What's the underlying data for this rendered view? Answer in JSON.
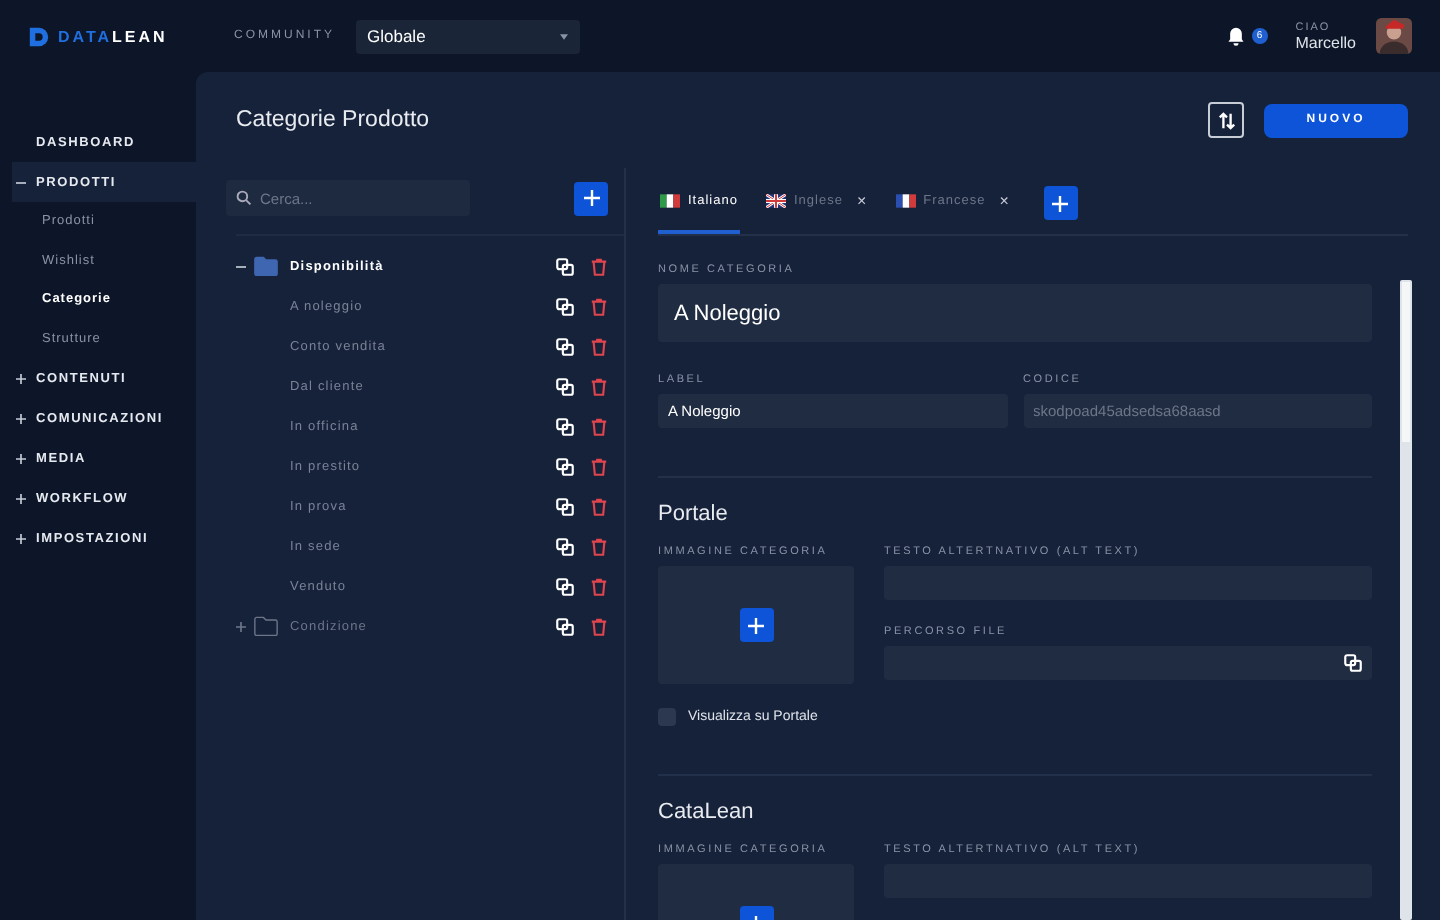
{
  "topbar": {
    "logo": [
      "DATA",
      "LEAN"
    ],
    "community_label": "COMMUNITY",
    "community_value": "Globale",
    "notifications": "6",
    "greeting": "CIAO",
    "user": "Marcello"
  },
  "sidebar": {
    "items": [
      {
        "label": "DASHBOARD",
        "kind": "link"
      },
      {
        "label": "PRODOTTI",
        "kind": "group",
        "expanded": true,
        "selected": true,
        "children": [
          {
            "label": "Prodotti",
            "selected": false
          },
          {
            "label": "Wishlist",
            "selected": false
          },
          {
            "label": "Categorie",
            "selected": true
          },
          {
            "label": "Strutture",
            "selected": false
          }
        ]
      },
      {
        "label": "CONTENUTI",
        "kind": "group",
        "expanded": false,
        "selected": false
      },
      {
        "label": "COMUNICAZIONI",
        "kind": "group",
        "expanded": false,
        "selected": false
      },
      {
        "label": "MEDIA",
        "kind": "group",
        "expanded": false,
        "selected": false
      },
      {
        "label": "WORKFLOW",
        "kind": "group",
        "expanded": false,
        "selected": false
      },
      {
        "label": "IMPOSTAZIONI",
        "kind": "group",
        "expanded": false,
        "selected": false
      }
    ]
  },
  "page": {
    "title": "Categorie Prodotto",
    "new_button": "NUOVO"
  },
  "search": {
    "placeholder": "Cerca..."
  },
  "tree": [
    {
      "label": "Disponibilità",
      "expanded": true,
      "children": [
        {
          "label": "A noleggio"
        },
        {
          "label": "Conto vendita"
        },
        {
          "label": "Dal cliente"
        },
        {
          "label": "In officina"
        },
        {
          "label": "In prestito"
        },
        {
          "label": "In prova"
        },
        {
          "label": "In sede"
        },
        {
          "label": "Venduto"
        }
      ]
    },
    {
      "label": "Condizione",
      "expanded": false
    }
  ],
  "tabs": [
    {
      "label": "Italiano",
      "kind": "it",
      "selected": true,
      "closable": false
    },
    {
      "label": "Inglese",
      "kind": "gb",
      "selected": false,
      "closable": true
    },
    {
      "label": "Francese",
      "kind": "fr",
      "selected": false,
      "closable": true
    }
  ],
  "close_mark": "×",
  "form": {
    "name_label": "NOME CATEGORIA",
    "name_value": "A Noleggio",
    "label_label": "LABEL",
    "label_value": "A Noleggio",
    "code_label": "CODICE",
    "code_value": "skodpoad45adsedsa68aasd",
    "code_disabled": true
  },
  "sections": [
    {
      "title": "Portale",
      "image_label": "IMMAGINE CATEGORIA",
      "alt_label": "TESTO ALTERTNATIVO (ALT TEXT)",
      "path_label": "PERCORSO FILE",
      "checkbox": {
        "label": "Visualizza su Portale",
        "checked": false
      }
    },
    {
      "title": "CataLean",
      "image_label": "IMMAGINE CATEGORIA",
      "alt_label": "TESTO ALTERTNATIVO (ALT TEXT)"
    }
  ]
}
